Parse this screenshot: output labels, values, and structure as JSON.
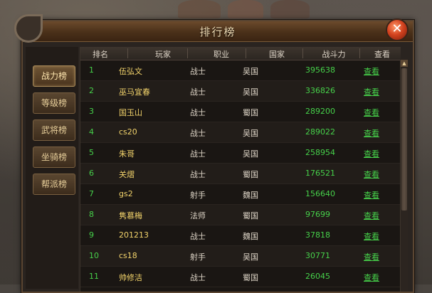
{
  "window": {
    "title": "排行榜",
    "close_symbol": "✕"
  },
  "sidebar": {
    "tabs": [
      {
        "label": "战力榜",
        "active": true
      },
      {
        "label": "等级榜",
        "active": false
      },
      {
        "label": "武将榜",
        "active": false
      },
      {
        "label": "坐骑榜",
        "active": false
      },
      {
        "label": "帮派榜",
        "active": false
      }
    ]
  },
  "table": {
    "headers": [
      "排名",
      "玩家",
      "职业",
      "国家",
      "战斗力",
      "查看"
    ],
    "view_label": "查看",
    "rows": [
      {
        "rank": "1",
        "name": "伍弘文",
        "job": "战士",
        "country": "吴国",
        "power": "395638"
      },
      {
        "rank": "2",
        "name": "巫马宜春",
        "job": "战士",
        "country": "吴国",
        "power": "336826"
      },
      {
        "rank": "3",
        "name": "国玉山",
        "job": "战士",
        "country": "蜀国",
        "power": "289200"
      },
      {
        "rank": "4",
        "name": "cs20",
        "job": "战士",
        "country": "吴国",
        "power": "289022"
      },
      {
        "rank": "5",
        "name": "朱哥",
        "job": "战士",
        "country": "吴国",
        "power": "258954"
      },
      {
        "rank": "6",
        "name": "关熠",
        "job": "战士",
        "country": "蜀国",
        "power": "176521"
      },
      {
        "rank": "7",
        "name": "gs2",
        "job": "射手",
        "country": "魏国",
        "power": "156640"
      },
      {
        "rank": "8",
        "name": "隽慕梅",
        "job": "法师",
        "country": "蜀国",
        "power": "97699"
      },
      {
        "rank": "9",
        "name": "201213",
        "job": "战士",
        "country": "魏国",
        "power": "37818"
      },
      {
        "rank": "10",
        "name": "cs18",
        "job": "射手",
        "country": "吴国",
        "power": "30771"
      },
      {
        "rank": "11",
        "name": "帅修洁",
        "job": "战士",
        "country": "蜀国",
        "power": "26045"
      }
    ]
  },
  "colors": {
    "accent_green": "#46d14a",
    "name_gold": "#f2d36b",
    "title_text": "#f0dcb4"
  }
}
